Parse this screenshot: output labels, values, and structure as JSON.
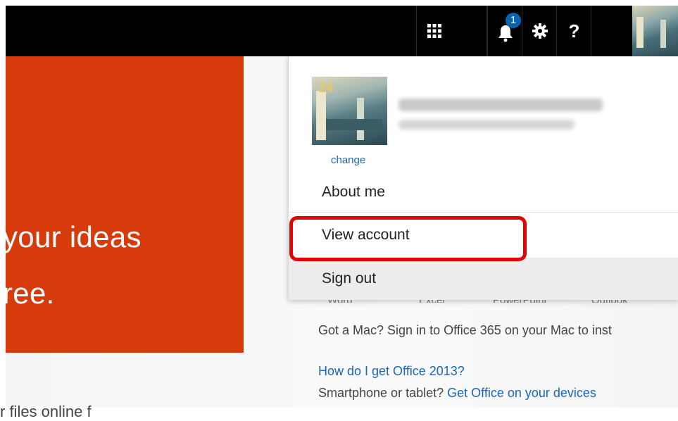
{
  "topbar": {
    "icons": [
      "app-launcher-icon",
      "bell-icon",
      "gear-icon",
      "help-icon"
    ],
    "notification_count": "1",
    "help_label": "?"
  },
  "hero": {
    "line1": "your ideas",
    "line2": "ree.",
    "below_text": "r files online f"
  },
  "page": {
    "app_labels": [
      "Word",
      "Excel",
      "PowerPoint",
      "Outlook"
    ],
    "mac_text": "Got a Mac? Sign in to Office 365 on your Mac to inst",
    "office2013_link": "How do I get Office 2013?",
    "phone_text": "Smartphone or tablet?",
    "devices_link": "Get Office on your devices"
  },
  "account_menu": {
    "photo_badge": "24",
    "change_label": "change",
    "items": [
      {
        "label": "About me"
      },
      {
        "label": "View account"
      },
      {
        "label": "Sign out"
      }
    ]
  },
  "colors": {
    "topbar": "#000000",
    "hero": "#d83b0b",
    "link": "#1a66b8",
    "badge": "#0a64b4",
    "highlight": "#e60000"
  }
}
